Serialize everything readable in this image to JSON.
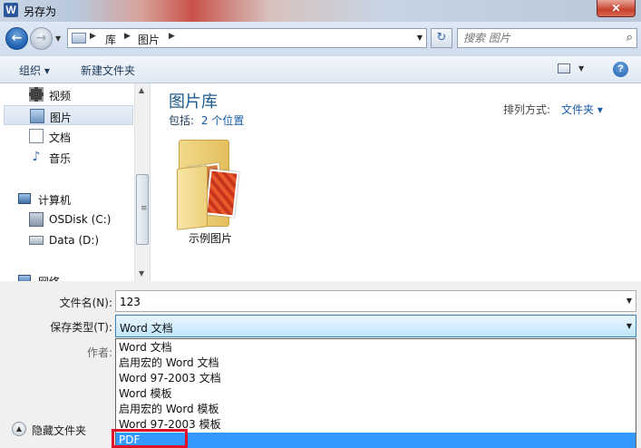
{
  "window": {
    "title": "另存为",
    "app_icon": "W"
  },
  "address": {
    "crumbs": [
      "库",
      "图片"
    ],
    "separator": "▶",
    "search_placeholder": "搜索 图片"
  },
  "toolbar": {
    "organize": "组织 ▾",
    "new_folder": "新建文件夹",
    "help": "?"
  },
  "nav": {
    "items": [
      {
        "label": "视频",
        "icon": "video-icon"
      },
      {
        "label": "图片",
        "icon": "pictures-icon",
        "selected": true
      },
      {
        "label": "文档",
        "icon": "documents-icon"
      },
      {
        "label": "音乐",
        "icon": "music-icon"
      }
    ],
    "computer": "计算机",
    "drives": [
      {
        "label": "OSDisk (C:)",
        "icon": "disk-drive-icon"
      },
      {
        "label": "Data (D:)",
        "icon": "disk-drive-icon"
      }
    ],
    "network": "网络"
  },
  "content": {
    "library_title": "图片库",
    "includes_label": "包括:",
    "includes_locations": "2 个位置",
    "arrange_label": "排列方式:",
    "arrange_value": "文件夹 ▾",
    "folder_name": "示例图片"
  },
  "form": {
    "filename_label": "文件名(N):",
    "filename_value": "123",
    "savetype_label": "保存类型(T):",
    "savetype_value": "Word 文档",
    "author_label": "作者:",
    "hide_folders": "隐藏文件夹",
    "options": [
      "Word 文档",
      "启用宏的 Word 文档",
      "Word 97-2003 文档",
      "Word 模板",
      "启用宏的 Word 模板",
      "Word 97-2003 模板",
      "PDF"
    ],
    "highlighted_option": "PDF"
  },
  "colors": {
    "accent": "#3399ff",
    "highlight_box": "#e0112b",
    "library_title": "#1e5a8a"
  }
}
